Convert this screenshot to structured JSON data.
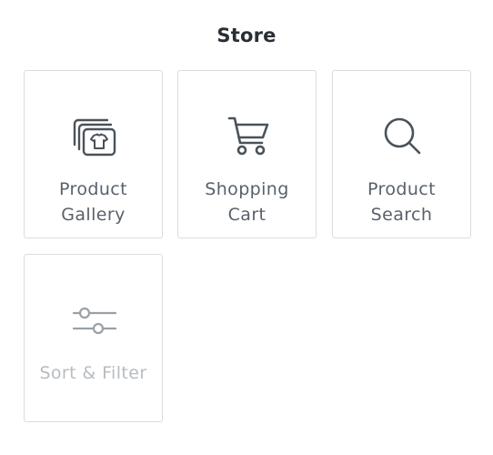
{
  "page": {
    "title": "Store"
  },
  "tiles": [
    {
      "label": "Product Gallery",
      "icon": "gallery-shirt-icon",
      "disabled": false
    },
    {
      "label": "Shopping Cart",
      "icon": "shopping-cart-icon",
      "disabled": false
    },
    {
      "label": "Product Search",
      "icon": "search-icon",
      "disabled": false
    },
    {
      "label": "Sort & Filter",
      "icon": "sliders-icon",
      "disabled": true
    }
  ],
  "colors": {
    "icon_active": "#4a525a",
    "icon_disabled": "#9aa0a6",
    "label_active": "#59616a",
    "label_disabled": "#b7bcc1",
    "border": "#dcdcdc"
  }
}
